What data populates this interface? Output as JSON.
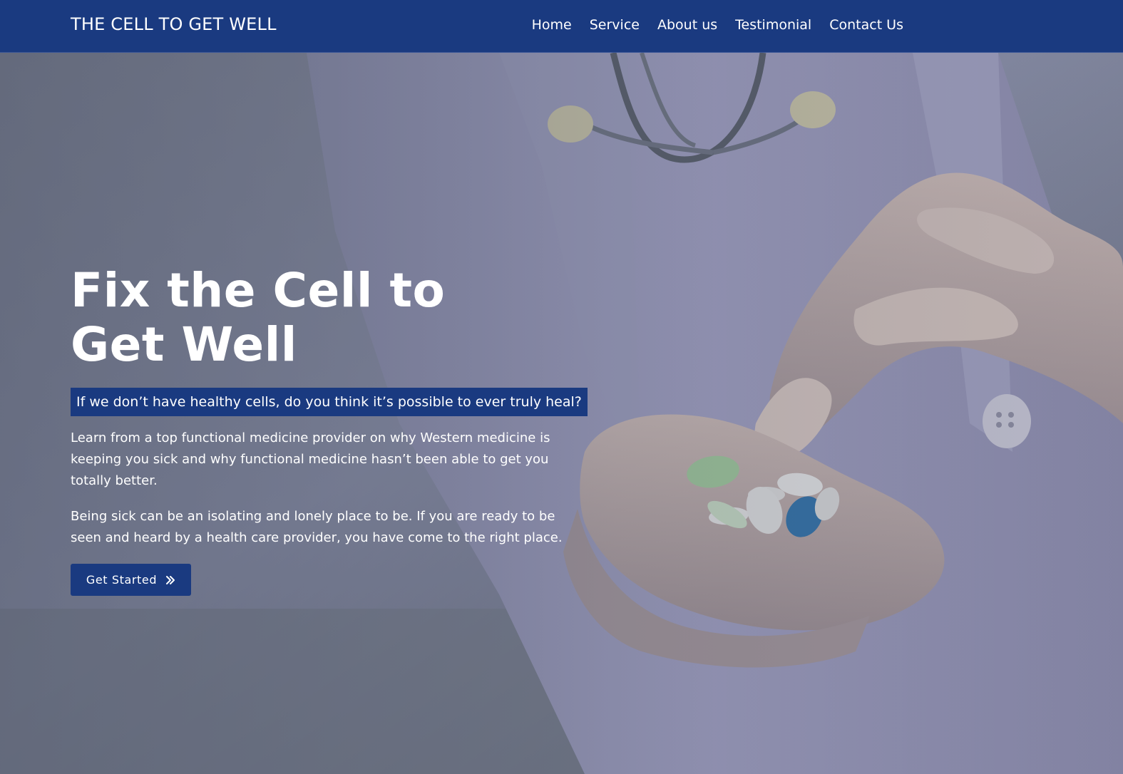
{
  "header": {
    "brand": "THE CELL TO GET WELL",
    "nav": [
      "Home",
      "Service",
      "About us",
      "Testimonial",
      "Contact Us"
    ]
  },
  "hero": {
    "headline_line1": "Fix the Cell to",
    "headline_line2": "Get Well",
    "tagline": "If we don’t have healthy cells, do you think it’s possible to ever truly heal?",
    "paragraph1": "Learn from a top functional medicine provider on why Western medicine is keeping you sick and why functional medicine hasn’t been able to get you totally better.",
    "paragraph2": "Being sick can be an isolating and lonely place to be. If you are ready to be seen and heard by a health care provider, you have come to the right place.",
    "cta_label": "Get Started",
    "cta_icon": "double-chevron-right-icon"
  },
  "colors": {
    "navy": "#1a3a80",
    "overlay": "#5e6577",
    "text": "#ffffff"
  }
}
